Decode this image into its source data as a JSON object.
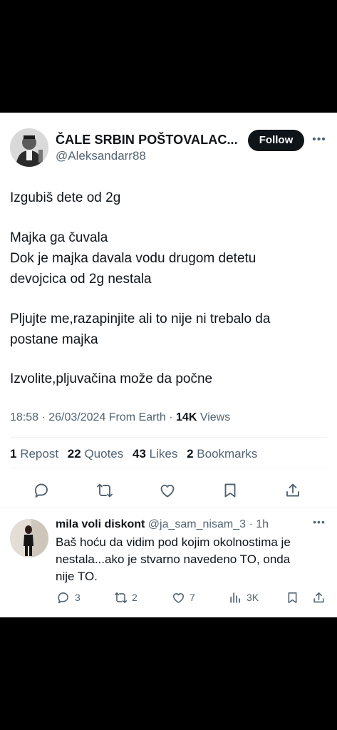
{
  "tweet": {
    "author_name": "ČALE SRBIN POŠTOVALAC...",
    "author_handle": "@Aleksandarr88",
    "follow_label": "Follow",
    "body_lines": [
      "Izgubiš dete od 2g",
      "Majka ga čuvala",
      "Dok je majka davala vodu drugom detetu",
      "devojcica od 2g nestala",
      "Pljujte me,razapinjite ali to nije ni trebalo da",
      "postane majka",
      "Izvolite,pljuvačina može da počne"
    ],
    "meta": {
      "time_date_source": "18:58 · 26/03/2024 From Earth · ",
      "views_count": "14K",
      "views_label": " Views"
    },
    "stats": {
      "reposts_count": "1",
      "reposts_label": " Repost",
      "quotes_count": "22",
      "quotes_label": " Quotes",
      "likes_count": "43",
      "likes_label": " Likes",
      "bookmarks_count": "2",
      "bookmarks_label": " Bookmarks"
    },
    "actions": [
      "reply-icon",
      "repost-icon",
      "like-icon",
      "bookmark-icon",
      "share-icon"
    ]
  },
  "reply": {
    "author_name": "mila voli diskont",
    "author_handle": " @ja_sam_nisam_3 · 1h",
    "text_lines": [
      "Baš hoću da vidim pod kojim okolnostima je",
      "nestala...ako je stvarno navedeno TO, onda",
      "nije TO."
    ],
    "replies_count": "3",
    "reposts_count": "2",
    "likes_count": "7",
    "views_count": "3K"
  },
  "colors": {
    "text": "#0f1419",
    "secondary": "#536471",
    "divider": "#eff3f4",
    "follow_bg": "#0f1419",
    "page_bg": "#000000"
  }
}
